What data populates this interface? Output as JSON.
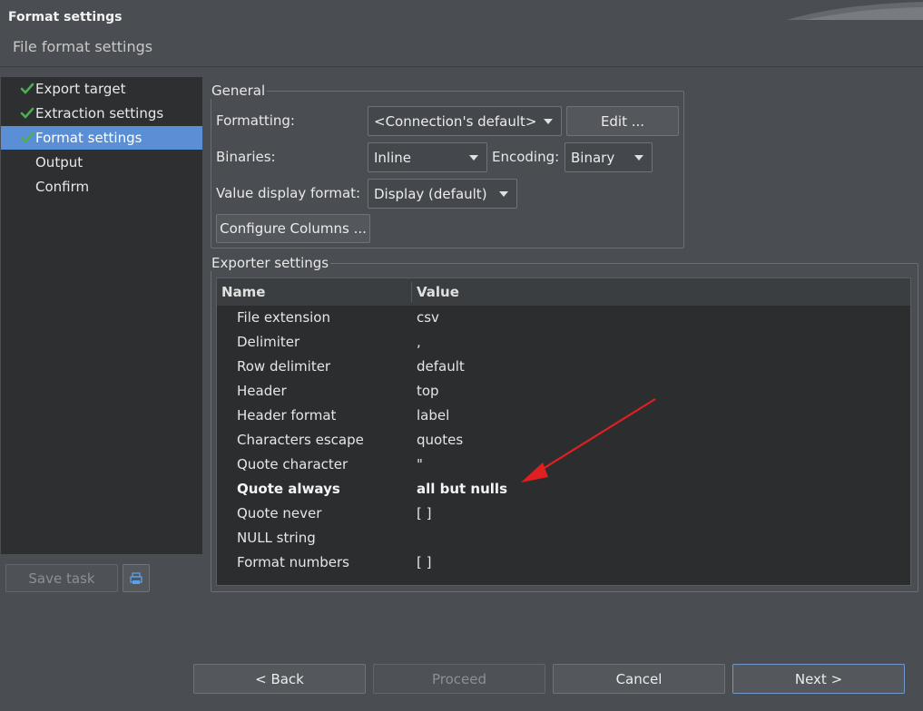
{
  "header": {
    "title": "Format settings",
    "subtitle": "File format settings"
  },
  "nav": {
    "items": [
      {
        "label": "Export target",
        "done": true,
        "selected": false
      },
      {
        "label": "Extraction settings",
        "done": true,
        "selected": false
      },
      {
        "label": "Format settings",
        "done": true,
        "selected": true
      },
      {
        "label": "Output",
        "done": false,
        "selected": false
      },
      {
        "label": "Confirm",
        "done": false,
        "selected": false
      }
    ]
  },
  "side_buttons": {
    "save_task": "Save task",
    "task_icon": "printer-icon"
  },
  "general": {
    "title": "General",
    "formatting_label": "Formatting:",
    "formatting_value": "<Connection's default>",
    "edit_button": "Edit ...",
    "binaries_label": "Binaries:",
    "binaries_value": "Inline",
    "encoding_label": "Encoding:",
    "encoding_value": "Binary",
    "value_display_label": "Value display format:",
    "value_display_value": "Display (default)",
    "configure_columns": "Configure Columns ..."
  },
  "exporter": {
    "title": "Exporter settings",
    "columns": {
      "name": "Name",
      "value": "Value"
    },
    "rows": [
      {
        "name": "File extension",
        "value": "csv",
        "bold": false
      },
      {
        "name": "Delimiter",
        "value": ",",
        "bold": false
      },
      {
        "name": "Row delimiter",
        "value": "default",
        "bold": false
      },
      {
        "name": "Header",
        "value": "top",
        "bold": false
      },
      {
        "name": "Header format",
        "value": "label",
        "bold": false
      },
      {
        "name": "Characters escape",
        "value": "quotes",
        "bold": false
      },
      {
        "name": "Quote character",
        "value": "\"",
        "bold": false
      },
      {
        "name": "Quote always",
        "value": "all but nulls",
        "bold": true
      },
      {
        "name": "Quote never",
        "value": "[  ]",
        "bold": false
      },
      {
        "name": "NULL string",
        "value": "",
        "bold": false
      },
      {
        "name": "Format numbers",
        "value": "[  ]",
        "bold": false
      }
    ]
  },
  "footer": {
    "back": "< Back",
    "proceed": "Proceed",
    "cancel": "Cancel",
    "next": "Next >"
  },
  "colors": {
    "accent": "#5a8fd6",
    "check": "#4caf50",
    "annotation": "#e02020"
  }
}
